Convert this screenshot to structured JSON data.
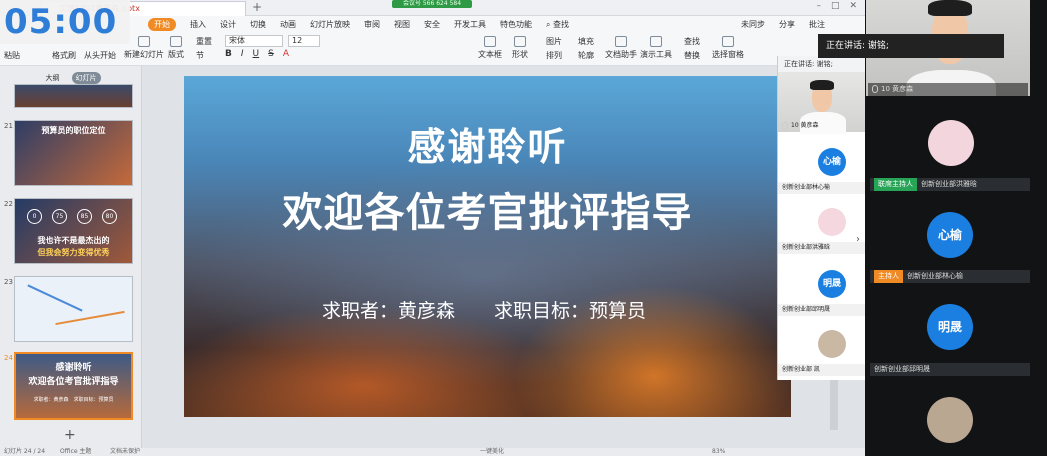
{
  "timer": "05:00",
  "titlebar": {
    "doc_tab": "工管1701黄彦森.pptx",
    "add_tab": "+",
    "meeting_id": "会议号 566 624 584",
    "right_icons": [
      "–",
      "□",
      "✕"
    ]
  },
  "menu": {
    "items": [
      "开始",
      "插入",
      "设计",
      "切换",
      "动画",
      "幻灯片放映",
      "审阅",
      "视图",
      "安全",
      "开发工具",
      "特色功能"
    ],
    "search": "查找",
    "right": [
      "未同步",
      "分享",
      "批注"
    ]
  },
  "ribbon": {
    "paste": "粘贴",
    "format_painter": "格式刷",
    "from_start": "从头开始",
    "new_slide": "新建幻灯片",
    "layout": "版式",
    "section": "节",
    "reset": "重置",
    "font": "宋体",
    "size": "12",
    "textbox": "文本框",
    "shape": "形状",
    "arrange": "排列",
    "outline": "轮廓",
    "image": "图片",
    "fill": "填充",
    "doc_helper": "文档助手",
    "presenter": "演示工具",
    "find": "查找",
    "replace": "替换",
    "select_pane": "选择窗格"
  },
  "leftpanel": {
    "tabs": [
      "大纲",
      "幻灯片"
    ],
    "slide_numbers": [
      "21",
      "22",
      "23",
      "24"
    ],
    "thumb21_title": "预算员的职位定位",
    "thumb22_line1": "我也许不是最杰出的",
    "thumb22_line2": "但我会努力变得优秀",
    "thumb22_circles": [
      "0",
      "75",
      "85",
      "80"
    ],
    "thumb24_t1": "感谢聆听",
    "thumb24_t2": "欢迎各位考官批评指导",
    "thumb24_sub": "求职者：黄彦森　求职目标：预算员"
  },
  "slide": {
    "title1": "感谢聆听",
    "title2": "欢迎各位考官批评指导",
    "applicant": "求职者：黄彦森",
    "goal": "求职目标：预算员"
  },
  "statusbar": {
    "slide_pos": "幻灯片 24 / 24",
    "theme": "Office 主题",
    "protect": "文档未保护",
    "beautify": "一键美化",
    "zoom": "83%"
  },
  "video_panel": {
    "speaking": "正在讲话: 谢铭;",
    "tiles": [
      {
        "name": "10 黄彦森"
      },
      {
        "name": "创新创业部林心榆",
        "avatar": "心榆"
      },
      {
        "name": "创新创业部洪雅晗"
      },
      {
        "name": "创新创业部邱明晟",
        "avatar": "明晟"
      },
      {
        "name": "创新创业部 凯"
      }
    ]
  },
  "right_panel": {
    "speaking": "正在讲话: 谢铭;",
    "self_label": "10 黄彦森",
    "tiles": [
      {
        "badge": "联席主持人",
        "name": "创新创业部洪雅晗",
        "badge_color": "#27a456"
      },
      {
        "badge": "主持人",
        "name": "创新创业部林心榆",
        "badge_color": "#f08a24",
        "avatar": "心榆"
      },
      {
        "badge": "",
        "name": "创新创业部邱明晟",
        "avatar": "明晟"
      }
    ]
  }
}
